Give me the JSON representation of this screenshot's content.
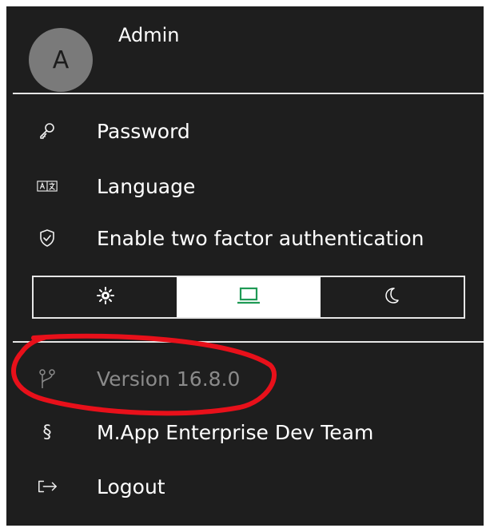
{
  "user": {
    "name": "Admin",
    "initial": "A"
  },
  "menu": {
    "password": "Password",
    "language": "Language",
    "two_factor": "Enable two factor authentication",
    "version": "Version 16.8.0",
    "team": "M.App Enterprise Dev Team",
    "logout": "Logout"
  },
  "icons": {
    "password": "key-icon",
    "language": "translate-icon",
    "two_factor": "shield-check-icon",
    "version": "git-branch-icon",
    "team": "section-sign-icon",
    "logout": "logout-icon"
  },
  "theme": {
    "options": [
      "light-sun-icon",
      "system-laptop-icon",
      "dark-moon-icon"
    ],
    "selected": "system-laptop-icon"
  },
  "colors": {
    "background": "#1e1e1e",
    "text": "#ffffff",
    "muted": "#8a8a8a",
    "accent_green": "#1f9a55",
    "annotation_red": "#e8101a"
  }
}
